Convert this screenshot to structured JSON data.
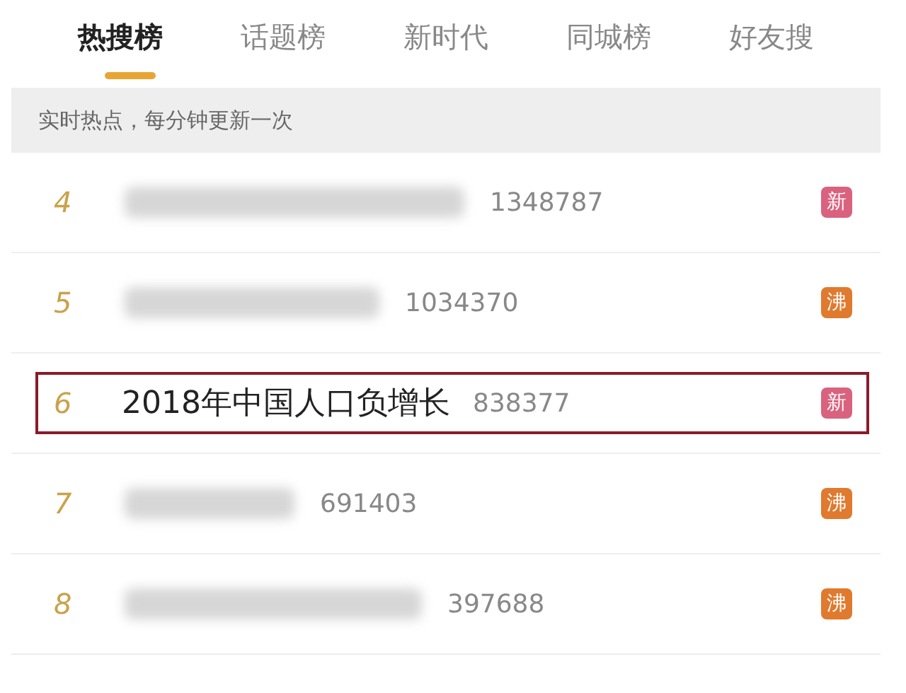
{
  "tabs": [
    {
      "label": "热搜榜",
      "selected": true
    },
    {
      "label": "话题榜",
      "selected": false
    },
    {
      "label": "新时代",
      "selected": false
    },
    {
      "label": "同城榜",
      "selected": false
    },
    {
      "label": "好友搜",
      "selected": false
    }
  ],
  "notice": "实时热点，每分钟更新一次",
  "rows": [
    {
      "rank": "4",
      "kind": "blurred",
      "count": "1348787",
      "badge": "新",
      "color": "#d9627f",
      "highlighted": false
    },
    {
      "rank": "5",
      "kind": "blurred",
      "count": "1034370",
      "badge": "沸",
      "color": "#e07a2e",
      "highlighted": false
    },
    {
      "rank": "6",
      "kind": "text",
      "title": "2018年中国人口负增长",
      "count": "838377",
      "badge": "新",
      "color": "#d9627f",
      "highlighted": true
    },
    {
      "rank": "7",
      "kind": "blurred",
      "count": "691403",
      "badge": "沸",
      "color": "#e07a2e",
      "highlighted": false
    },
    {
      "rank": "8",
      "kind": "blurred",
      "count": "397688",
      "badge": "沸",
      "color": "#e07a2e",
      "highlighted": false
    }
  ]
}
